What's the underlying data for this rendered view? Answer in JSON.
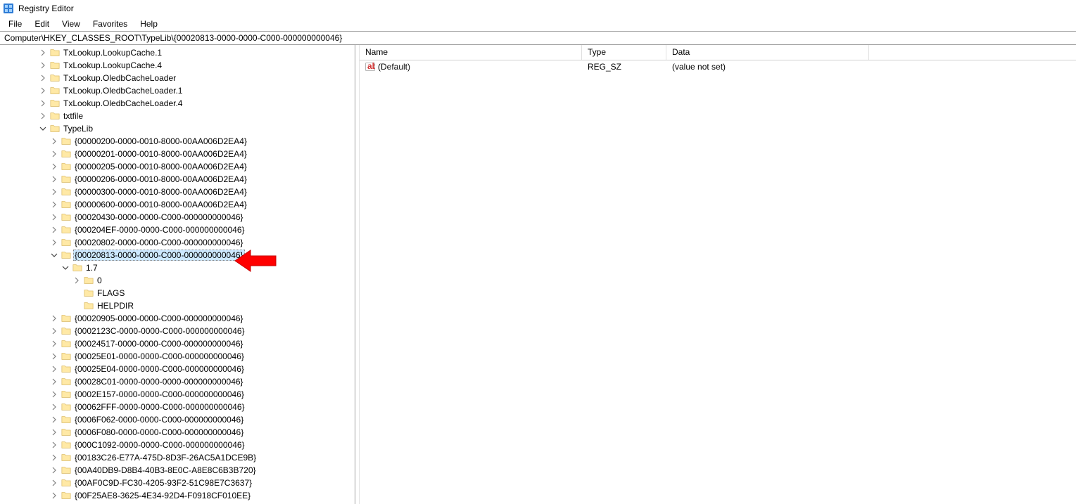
{
  "title": "Registry Editor",
  "menu": [
    "File",
    "Edit",
    "View",
    "Favorites",
    "Help"
  ],
  "address": "Computer\\HKEY_CLASSES_ROOT\\TypeLib\\{00020813-0000-0000-C000-000000000046}",
  "tree": [
    {
      "indent": 2,
      "exp": "closed",
      "label": "TxLookup.LookupCache.1"
    },
    {
      "indent": 2,
      "exp": "closed",
      "label": "TxLookup.LookupCache.4"
    },
    {
      "indent": 2,
      "exp": "closed",
      "label": "TxLookup.OledbCacheLoader"
    },
    {
      "indent": 2,
      "exp": "closed",
      "label": "TxLookup.OledbCacheLoader.1"
    },
    {
      "indent": 2,
      "exp": "closed",
      "label": "TxLookup.OledbCacheLoader.4"
    },
    {
      "indent": 2,
      "exp": "closed",
      "label": "txtfile"
    },
    {
      "indent": 2,
      "exp": "open",
      "label": "TypeLib"
    },
    {
      "indent": 3,
      "exp": "closed",
      "label": "{00000200-0000-0010-8000-00AA006D2EA4}"
    },
    {
      "indent": 3,
      "exp": "closed",
      "label": "{00000201-0000-0010-8000-00AA006D2EA4}"
    },
    {
      "indent": 3,
      "exp": "closed",
      "label": "{00000205-0000-0010-8000-00AA006D2EA4}"
    },
    {
      "indent": 3,
      "exp": "closed",
      "label": "{00000206-0000-0010-8000-00AA006D2EA4}"
    },
    {
      "indent": 3,
      "exp": "closed",
      "label": "{00000300-0000-0010-8000-00AA006D2EA4}"
    },
    {
      "indent": 3,
      "exp": "closed",
      "label": "{00000600-0000-0010-8000-00AA006D2EA4}"
    },
    {
      "indent": 3,
      "exp": "closed",
      "label": "{00020430-0000-0000-C000-000000000046}"
    },
    {
      "indent": 3,
      "exp": "closed",
      "label": "{000204EF-0000-0000-C000-000000000046}"
    },
    {
      "indent": 3,
      "exp": "closed",
      "label": "{00020802-0000-0000-C000-000000000046}"
    },
    {
      "indent": 3,
      "exp": "open",
      "label": "{00020813-0000-0000-C000-000000000046}",
      "selected": true
    },
    {
      "indent": 4,
      "exp": "open",
      "label": "1.7"
    },
    {
      "indent": 5,
      "exp": "closed",
      "label": "0"
    },
    {
      "indent": 5,
      "exp": "none",
      "label": "FLAGS"
    },
    {
      "indent": 5,
      "exp": "none",
      "label": "HELPDIR"
    },
    {
      "indent": 3,
      "exp": "closed",
      "label": "{00020905-0000-0000-C000-000000000046}"
    },
    {
      "indent": 3,
      "exp": "closed",
      "label": "{0002123C-0000-0000-C000-000000000046}"
    },
    {
      "indent": 3,
      "exp": "closed",
      "label": "{00024517-0000-0000-C000-000000000046}"
    },
    {
      "indent": 3,
      "exp": "closed",
      "label": "{00025E01-0000-0000-C000-000000000046}"
    },
    {
      "indent": 3,
      "exp": "closed",
      "label": "{00025E04-0000-0000-C000-000000000046}"
    },
    {
      "indent": 3,
      "exp": "closed",
      "label": "{00028C01-0000-0000-0000-000000000046}"
    },
    {
      "indent": 3,
      "exp": "closed",
      "label": "{0002E157-0000-0000-C000-000000000046}"
    },
    {
      "indent": 3,
      "exp": "closed",
      "label": "{00062FFF-0000-0000-C000-000000000046}"
    },
    {
      "indent": 3,
      "exp": "closed",
      "label": "{0006F062-0000-0000-C000-000000000046}"
    },
    {
      "indent": 3,
      "exp": "closed",
      "label": "{0006F080-0000-0000-C000-000000000046}"
    },
    {
      "indent": 3,
      "exp": "closed",
      "label": "{000C1092-0000-0000-C000-000000000046}"
    },
    {
      "indent": 3,
      "exp": "closed",
      "label": "{00183C26-E77A-475D-8D3F-26AC5A1DCE9B}"
    },
    {
      "indent": 3,
      "exp": "closed",
      "label": "{00A40DB9-D8B4-40B3-8E0C-A8E8C6B3B720}"
    },
    {
      "indent": 3,
      "exp": "closed",
      "label": "{00AF0C9D-FC30-4205-93F2-51C98E7C3637}"
    },
    {
      "indent": 3,
      "exp": "closed",
      "label": "{00F25AE8-3625-4E34-92D4-F0918CF010EE}"
    }
  ],
  "list": {
    "headers": {
      "name": "Name",
      "type": "Type",
      "data": "Data"
    },
    "rows": [
      {
        "name": "(Default)",
        "type": "REG_SZ",
        "data": "(value not set)"
      }
    ]
  }
}
